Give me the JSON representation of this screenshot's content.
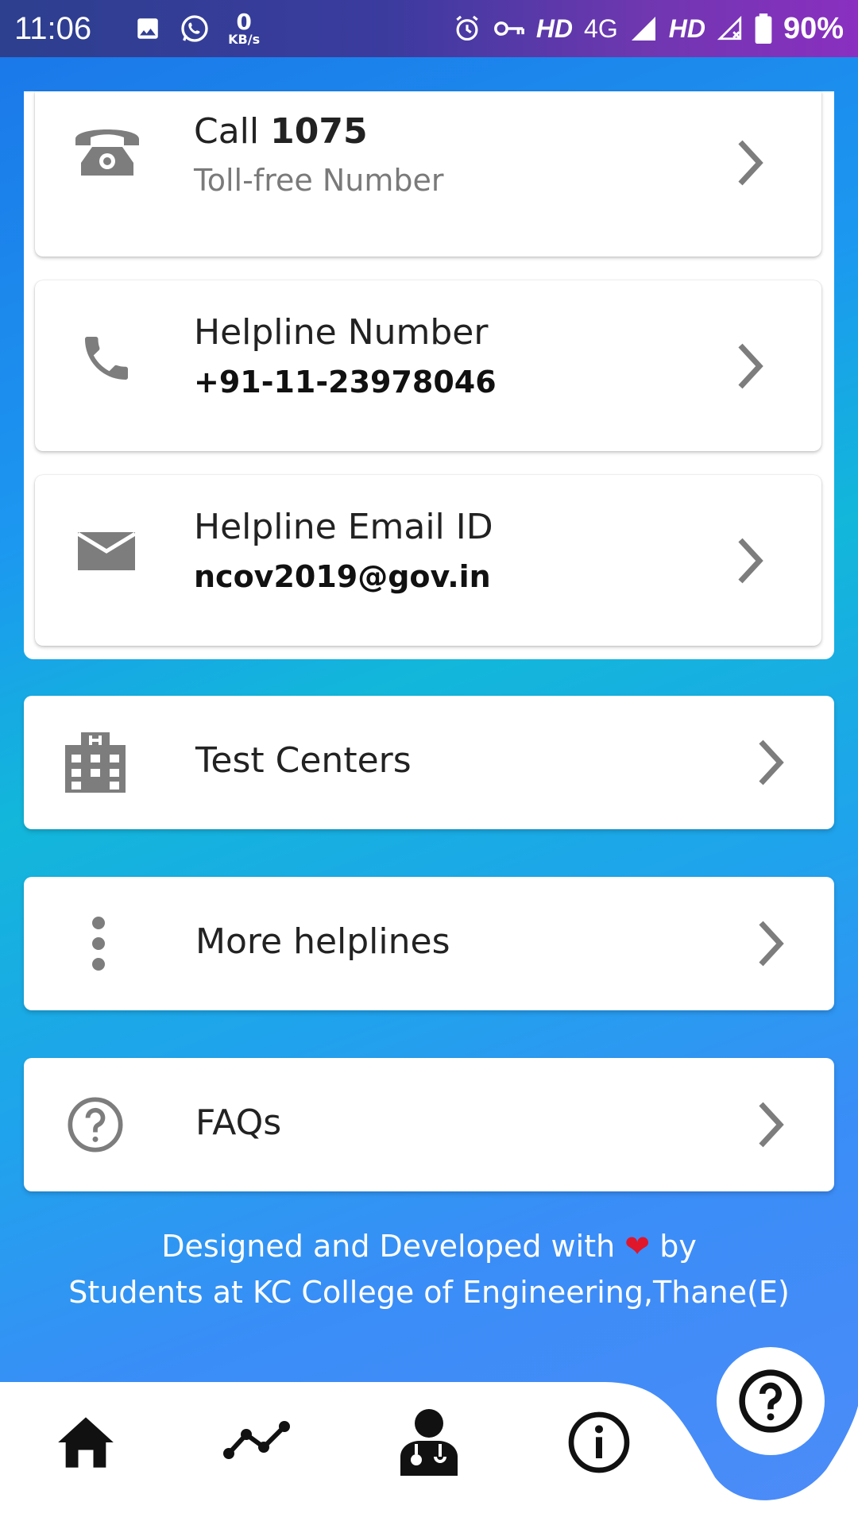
{
  "status_bar": {
    "time": "11:06",
    "speed_value": "0",
    "speed_unit": "KB/s",
    "network_hd1": "HD",
    "network_type": "4G",
    "network_hd2": "HD",
    "battery": "90%"
  },
  "contact_group": {
    "call": {
      "label_prefix": "Call",
      "number": "1075",
      "subtitle": "Toll-free Number"
    },
    "helpline": {
      "title": "Helpline Number",
      "value": "+91-11-23978046"
    },
    "email": {
      "title": "Helpline Email ID",
      "value": "ncov2019@gov.in"
    }
  },
  "menu": {
    "test_centers": "Test Centers",
    "more_helplines": "More helplines",
    "faqs": "FAQs"
  },
  "footer": {
    "line1_prefix": "Designed and Developed with",
    "line1_suffix": "by",
    "line2": "Students at KC College of Engineering,Thane(E)"
  },
  "icons": {
    "call": "telephone-icon",
    "helpline": "phone-icon",
    "email": "mail-icon",
    "test_centers": "hospital-building-icon",
    "more": "more-vertical-icon",
    "faqs": "help-circle-icon",
    "nav": [
      "home-icon",
      "stats-icon",
      "doctor-icon",
      "info-icon",
      "help-icon"
    ]
  },
  "colors": {
    "accent": "#2a7ff0",
    "heart": "#e0162b",
    "icon_gray": "#7d7d7d"
  }
}
